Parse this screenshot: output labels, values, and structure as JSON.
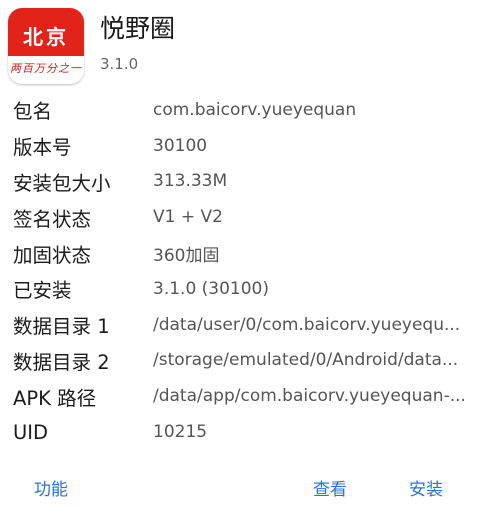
{
  "app": {
    "title": "悦野圈",
    "version": "3.1.0",
    "icon": {
      "name": "app-icon",
      "logo_text": "北京",
      "tagline": "两百万分之一",
      "brand_color": "#e2231a"
    }
  },
  "info_rows": [
    {
      "label": "包名",
      "value": "com.baicorv.yueyequan"
    },
    {
      "label": "版本号",
      "value": "30100"
    },
    {
      "label": "安装包大小",
      "value": "313.33M"
    },
    {
      "label": "签名状态",
      "value": "V1 + V2"
    },
    {
      "label": "加固状态",
      "value": "360加固"
    },
    {
      "label": "已安装",
      "value": "3.1.0 (30100)"
    },
    {
      "label": "数据目录 1",
      "value": "/data/user/0/com.baicorv.yueyequ..."
    },
    {
      "label": "数据目录 2",
      "value": "/storage/emulated/0/Android/data..."
    },
    {
      "label": "APK 路径",
      "value": "/data/app/com.baicorv.yueyequan-..."
    },
    {
      "label": "UID",
      "value": "10215"
    }
  ],
  "actions": {
    "function_label": "功能",
    "view_label": "查看",
    "install_label": "安装",
    "accent_color": "#2b73d9"
  }
}
